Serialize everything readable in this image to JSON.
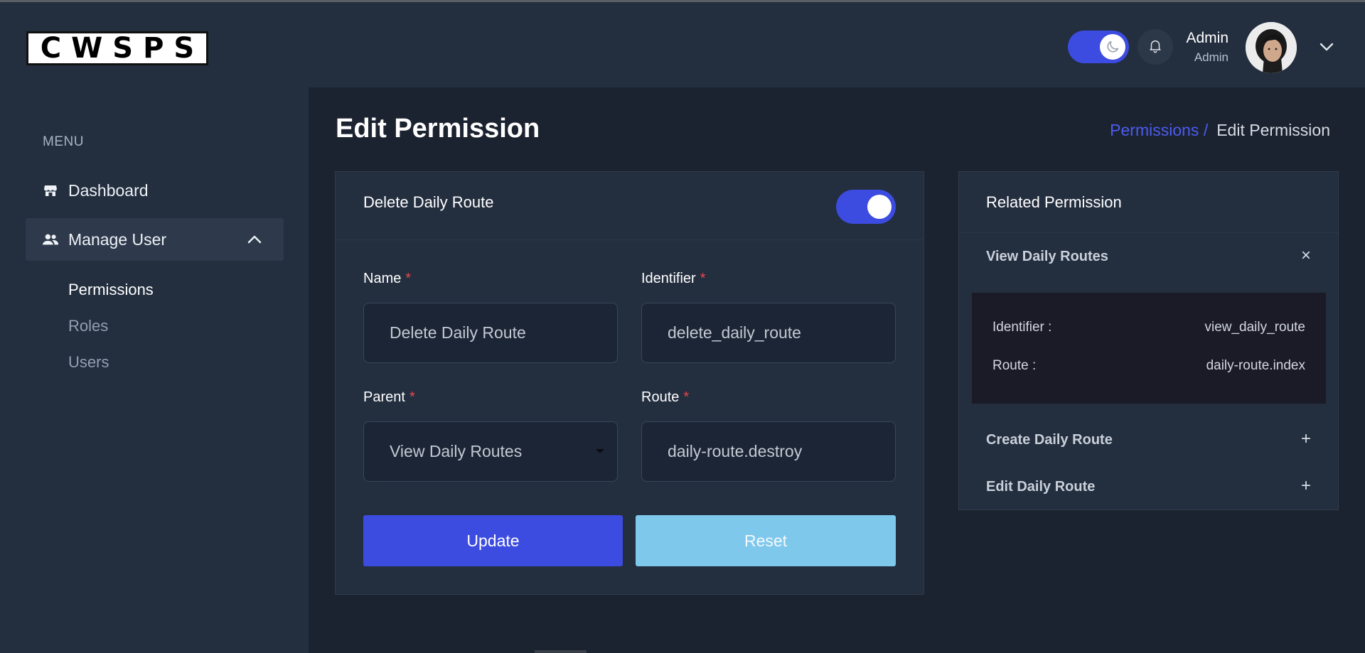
{
  "brand": {
    "logo_text": "CWSPS"
  },
  "header": {
    "user_name": "Admin",
    "user_role": "Admin",
    "theme_mode": "dark",
    "icons": {
      "theme": "moon-icon",
      "notifications": "bell-icon",
      "menu": "chevron-down-icon"
    }
  },
  "sidebar": {
    "menu_label": "MENU",
    "items": [
      {
        "label": "Dashboard",
        "icon": "store-icon"
      },
      {
        "label": "Manage User",
        "icon": "users-icon",
        "expanded": true
      }
    ],
    "sub_items": [
      {
        "label": "Permissions",
        "active": true
      },
      {
        "label": "Roles",
        "active": false
      },
      {
        "label": "Users",
        "active": false
      }
    ]
  },
  "page": {
    "title": "Edit Permission",
    "breadcrumb": {
      "parent": "Permissions /",
      "current": "Edit Permission"
    }
  },
  "form": {
    "card_title": "Delete Daily Route",
    "active": true,
    "fields": {
      "name": {
        "label": "Name",
        "required_mark": "*",
        "value": "Delete Daily Route"
      },
      "identifier": {
        "label": "Identifier",
        "required_mark": "*",
        "value": "delete_daily_route"
      },
      "parent": {
        "label": "Parent",
        "required_mark": "*",
        "value": "View Daily Routes"
      },
      "route": {
        "label": "Route",
        "required_mark": "*",
        "value": "daily-route.destroy"
      }
    },
    "buttons": {
      "update": "Update",
      "reset": "Reset"
    }
  },
  "related": {
    "title": "Related Permission",
    "items": [
      {
        "title": "View Daily Routes",
        "toggle": "×",
        "expanded": true,
        "identifier_label": "Identifier :",
        "identifier_value": "view_daily_route",
        "route_label": "Route :",
        "route_value": "daily-route.index"
      },
      {
        "title": "Create Daily Route",
        "toggle": "+",
        "expanded": false
      },
      {
        "title": "Edit Daily Route",
        "toggle": "+",
        "expanded": false
      }
    ]
  },
  "colors": {
    "accent": "#3d4ce0",
    "reset_button": "#7ec8ec",
    "required": "#e5484d",
    "panel": "#232e3f",
    "background": "#1c2330"
  }
}
